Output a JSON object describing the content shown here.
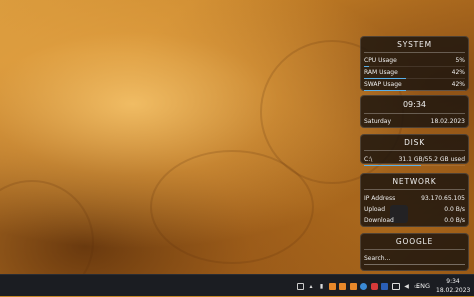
{
  "system": {
    "title": "SYSTEM",
    "rows": [
      {
        "label": "CPU Usage",
        "value": "5%",
        "percent": 5
      },
      {
        "label": "RAM Usage",
        "value": "42%",
        "percent": 42
      },
      {
        "label": "SWAP Usage",
        "value": "42%",
        "percent": 42
      }
    ]
  },
  "clock_widget": {
    "time": "09:34",
    "day": "Saturday",
    "date": "18.02.2023"
  },
  "disk": {
    "title": "DISK",
    "drive": "C:\\",
    "usage": "31.1 GB/55.2 GB used",
    "percent": 56
  },
  "network": {
    "title": "NETWORK",
    "rows": [
      {
        "label": "IP Address",
        "value": "93.170.65.105"
      },
      {
        "label": "Upload",
        "value": "0.0 B/s"
      },
      {
        "label": "Download",
        "value": "0.0 B/s"
      }
    ]
  },
  "google": {
    "title": "GOOGLE",
    "placeholder": "Search..."
  },
  "taskbar": {
    "language": "ENG",
    "time": "9:34",
    "date": "18.02.2023",
    "tray_icons": [
      "chat-icon",
      "flame-icon",
      "usb-icon",
      "app-orange-icon",
      "app-orange-icon",
      "app-orange-icon",
      "vpn-icon",
      "shield-icon",
      "flag-icon",
      "display-icon",
      "speaker-icon",
      "network-icon"
    ]
  },
  "colors": {
    "accent_bar": "#5ab0e8",
    "taskbar": "#1b1d22",
    "widget_bg": "#1c140e"
  }
}
